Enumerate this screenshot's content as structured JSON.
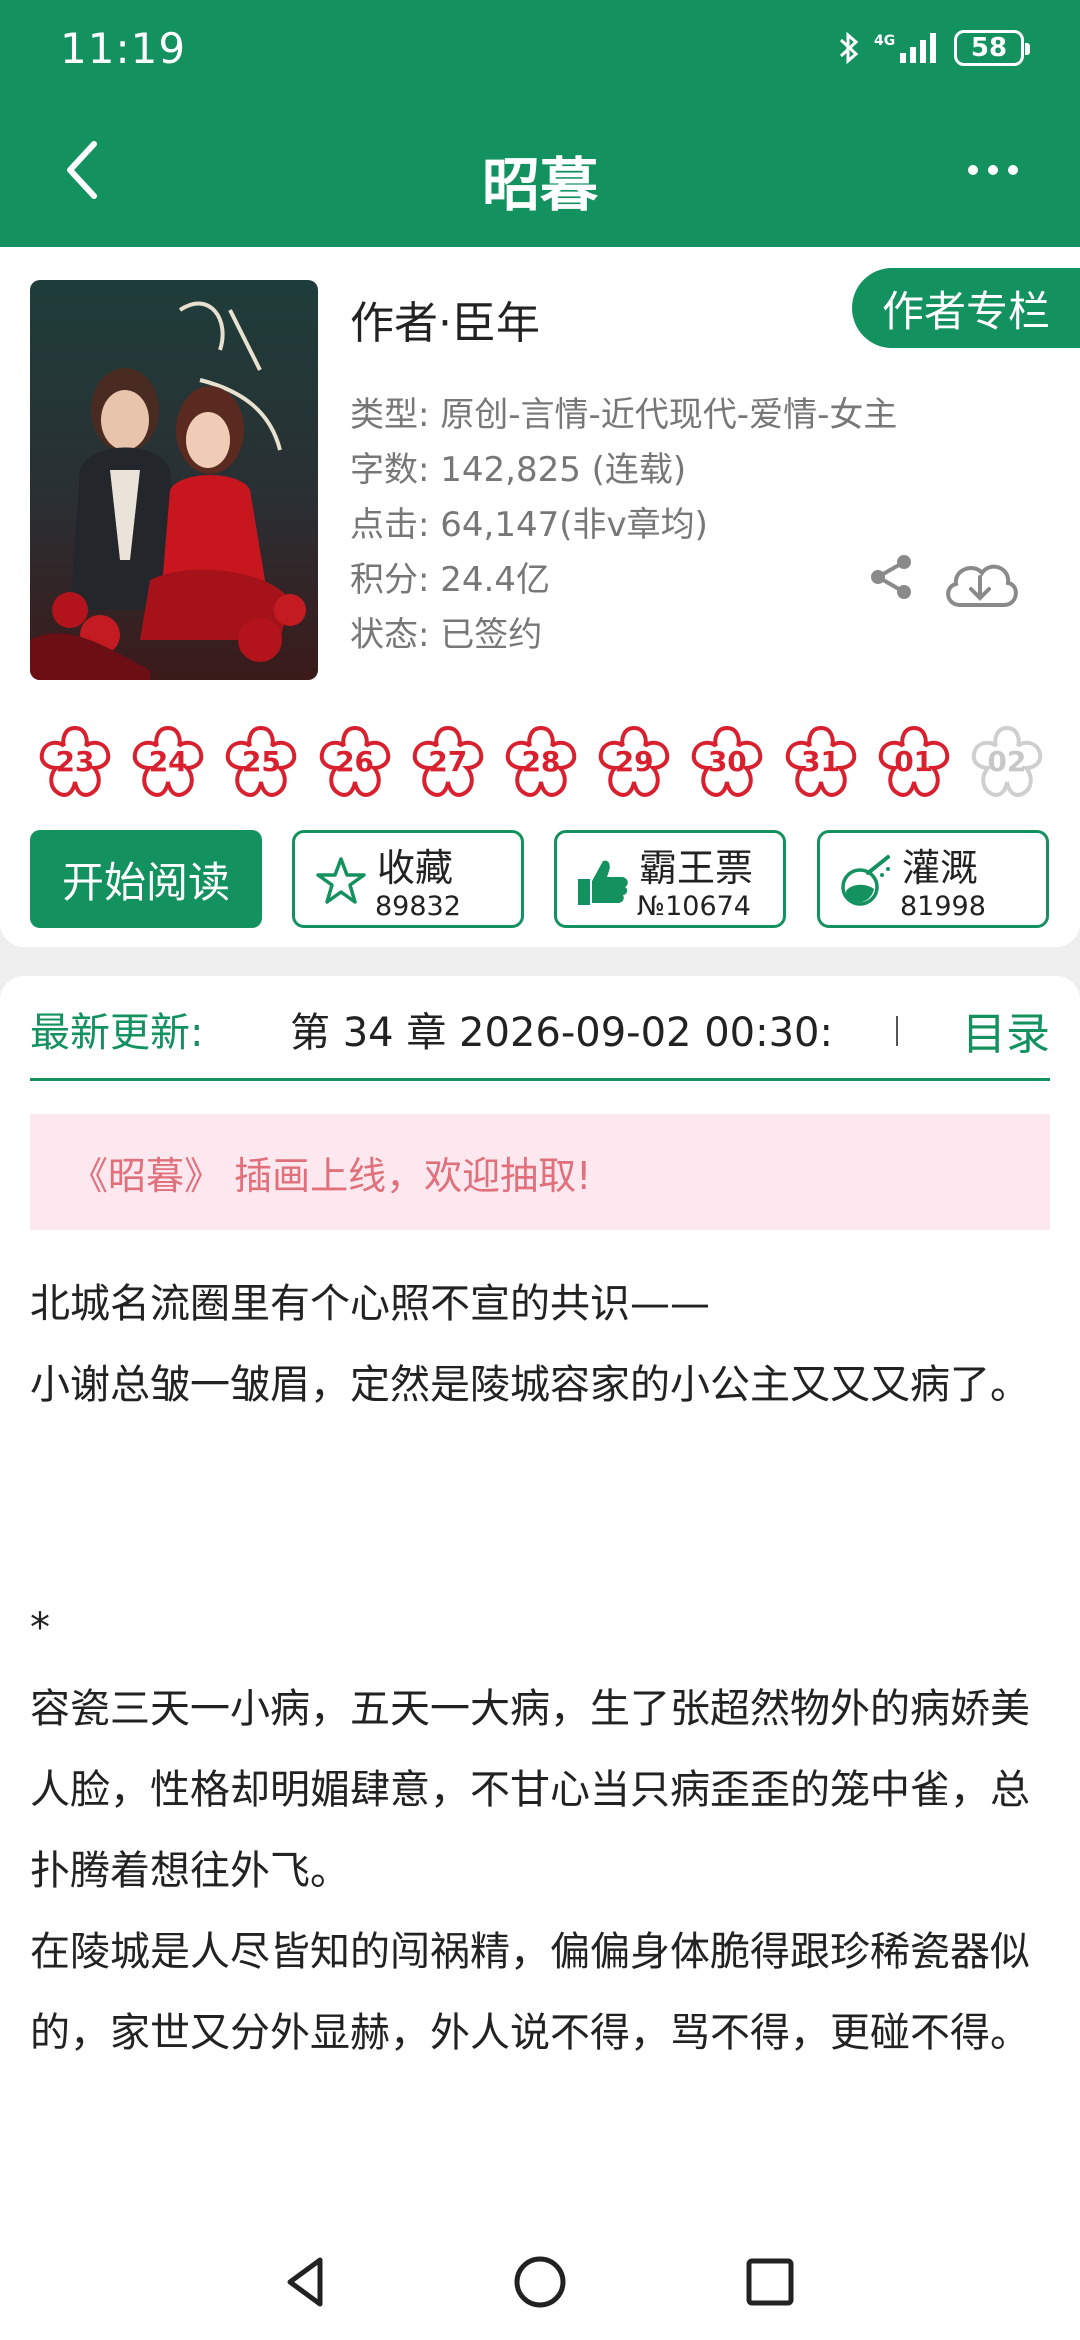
{
  "status_bar": {
    "time": "11:19",
    "network": "4G",
    "battery": "58",
    "icons": [
      "bluetooth-icon",
      "signal-icon",
      "battery-icon"
    ]
  },
  "header": {
    "title": "昭暮",
    "back_icon": "chevron-left-icon",
    "more_icon": "more-dots-icon"
  },
  "book": {
    "author": "作者·臣年",
    "author_column_label": "作者专栏",
    "meta": [
      "类型: 原创-言情-近代现代-爱情-女主",
      "字数: 142,825 (连载)",
      "点击: 64,147(非v章均)",
      "积分: 24.4亿",
      "状态: 已签约"
    ]
  },
  "flowers": [
    {
      "label": "23",
      "active": true
    },
    {
      "label": "24",
      "active": true
    },
    {
      "label": "25",
      "active": true
    },
    {
      "label": "26",
      "active": true
    },
    {
      "label": "27",
      "active": true
    },
    {
      "label": "28",
      "active": true
    },
    {
      "label": "29",
      "active": true
    },
    {
      "label": "30",
      "active": true
    },
    {
      "label": "31",
      "active": true
    },
    {
      "label": "01",
      "active": true
    },
    {
      "label": "02",
      "active": false
    }
  ],
  "actions": {
    "start_reading": "开始阅读",
    "collect": {
      "label": "收藏",
      "count": "89832"
    },
    "ticket": {
      "label": "霸王票",
      "count": "№10674"
    },
    "water": {
      "label": "灌溉",
      "count": "81998"
    }
  },
  "latest": {
    "label": "最新更新:",
    "chapter": "第 34 章  2026-09-02 00:30:",
    "toc": "目录"
  },
  "announcement": "《昭暮》 插画上线，欢迎抽取!",
  "content": {
    "p1": "北城名流圈里有个心照不宣的共识——",
    "p2": "小谢总皱一皱眉，定然是陵城容家的小公主又又又病了。",
    "p3": "*",
    "p4": "容瓷三天一小病，五天一大病，生了张超然物外的病娇美人脸，性格却明媚肆意，不甘心当只病歪歪的笼中雀，总扑腾着想往外飞。",
    "p5": "在陵城是人尽皆知的闯祸精，偏偏身体脆得跟珍稀瓷器似的，家世又分外显赫，外人说不得，骂不得，更碰不得。"
  },
  "colors": {
    "primary": "#13915f",
    "flower_red": "#d9202e",
    "announce_bg": "#fce8ee",
    "announce_text": "#e0707c"
  }
}
